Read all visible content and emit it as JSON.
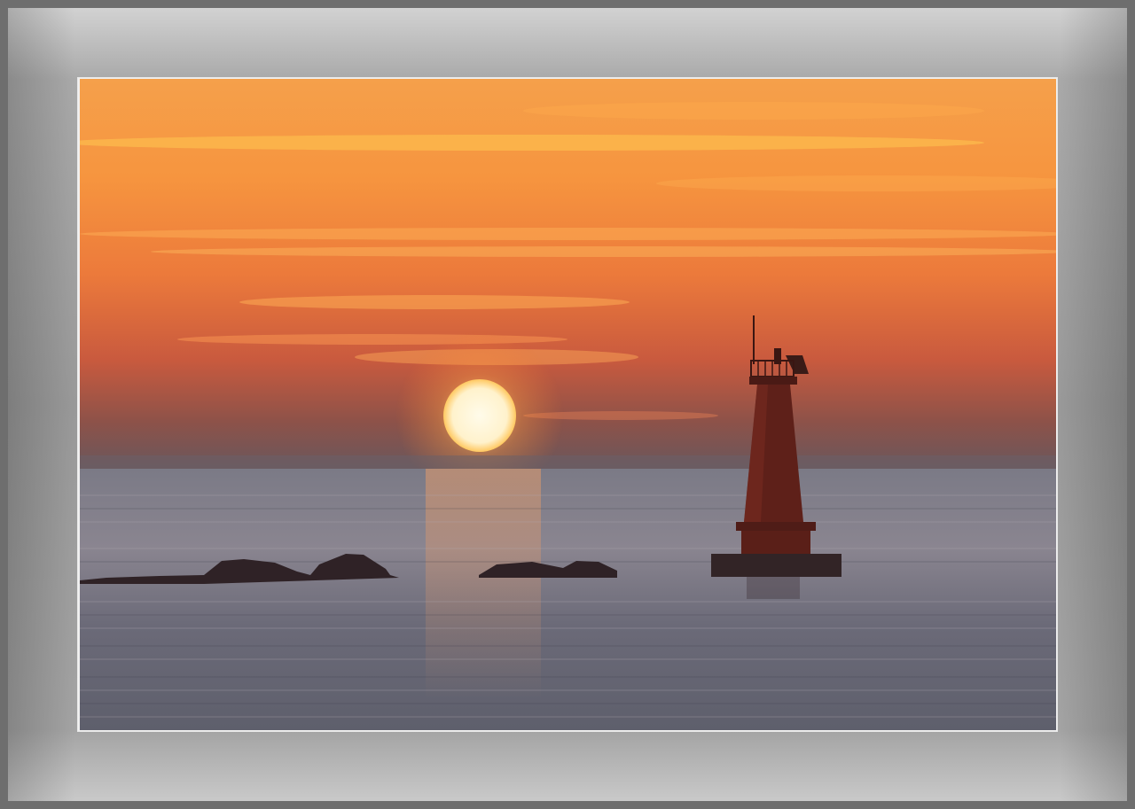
{
  "scene": {
    "subject": "sunset-over-sea-with-lighthouse",
    "colors": {
      "sky_top": "#f6a04a",
      "sky_mid": "#f28a3c",
      "sky_low": "#d6603a",
      "sky_horizon": "#6b5257",
      "sun": "#fff4d8",
      "sun_glow": "#ffb347",
      "sea": "#7d7b85",
      "sea_dark": "#4c4c56",
      "lighthouse": "#5a1e18",
      "rocks": "#2e2224",
      "mat": "#a8a8a8"
    }
  }
}
